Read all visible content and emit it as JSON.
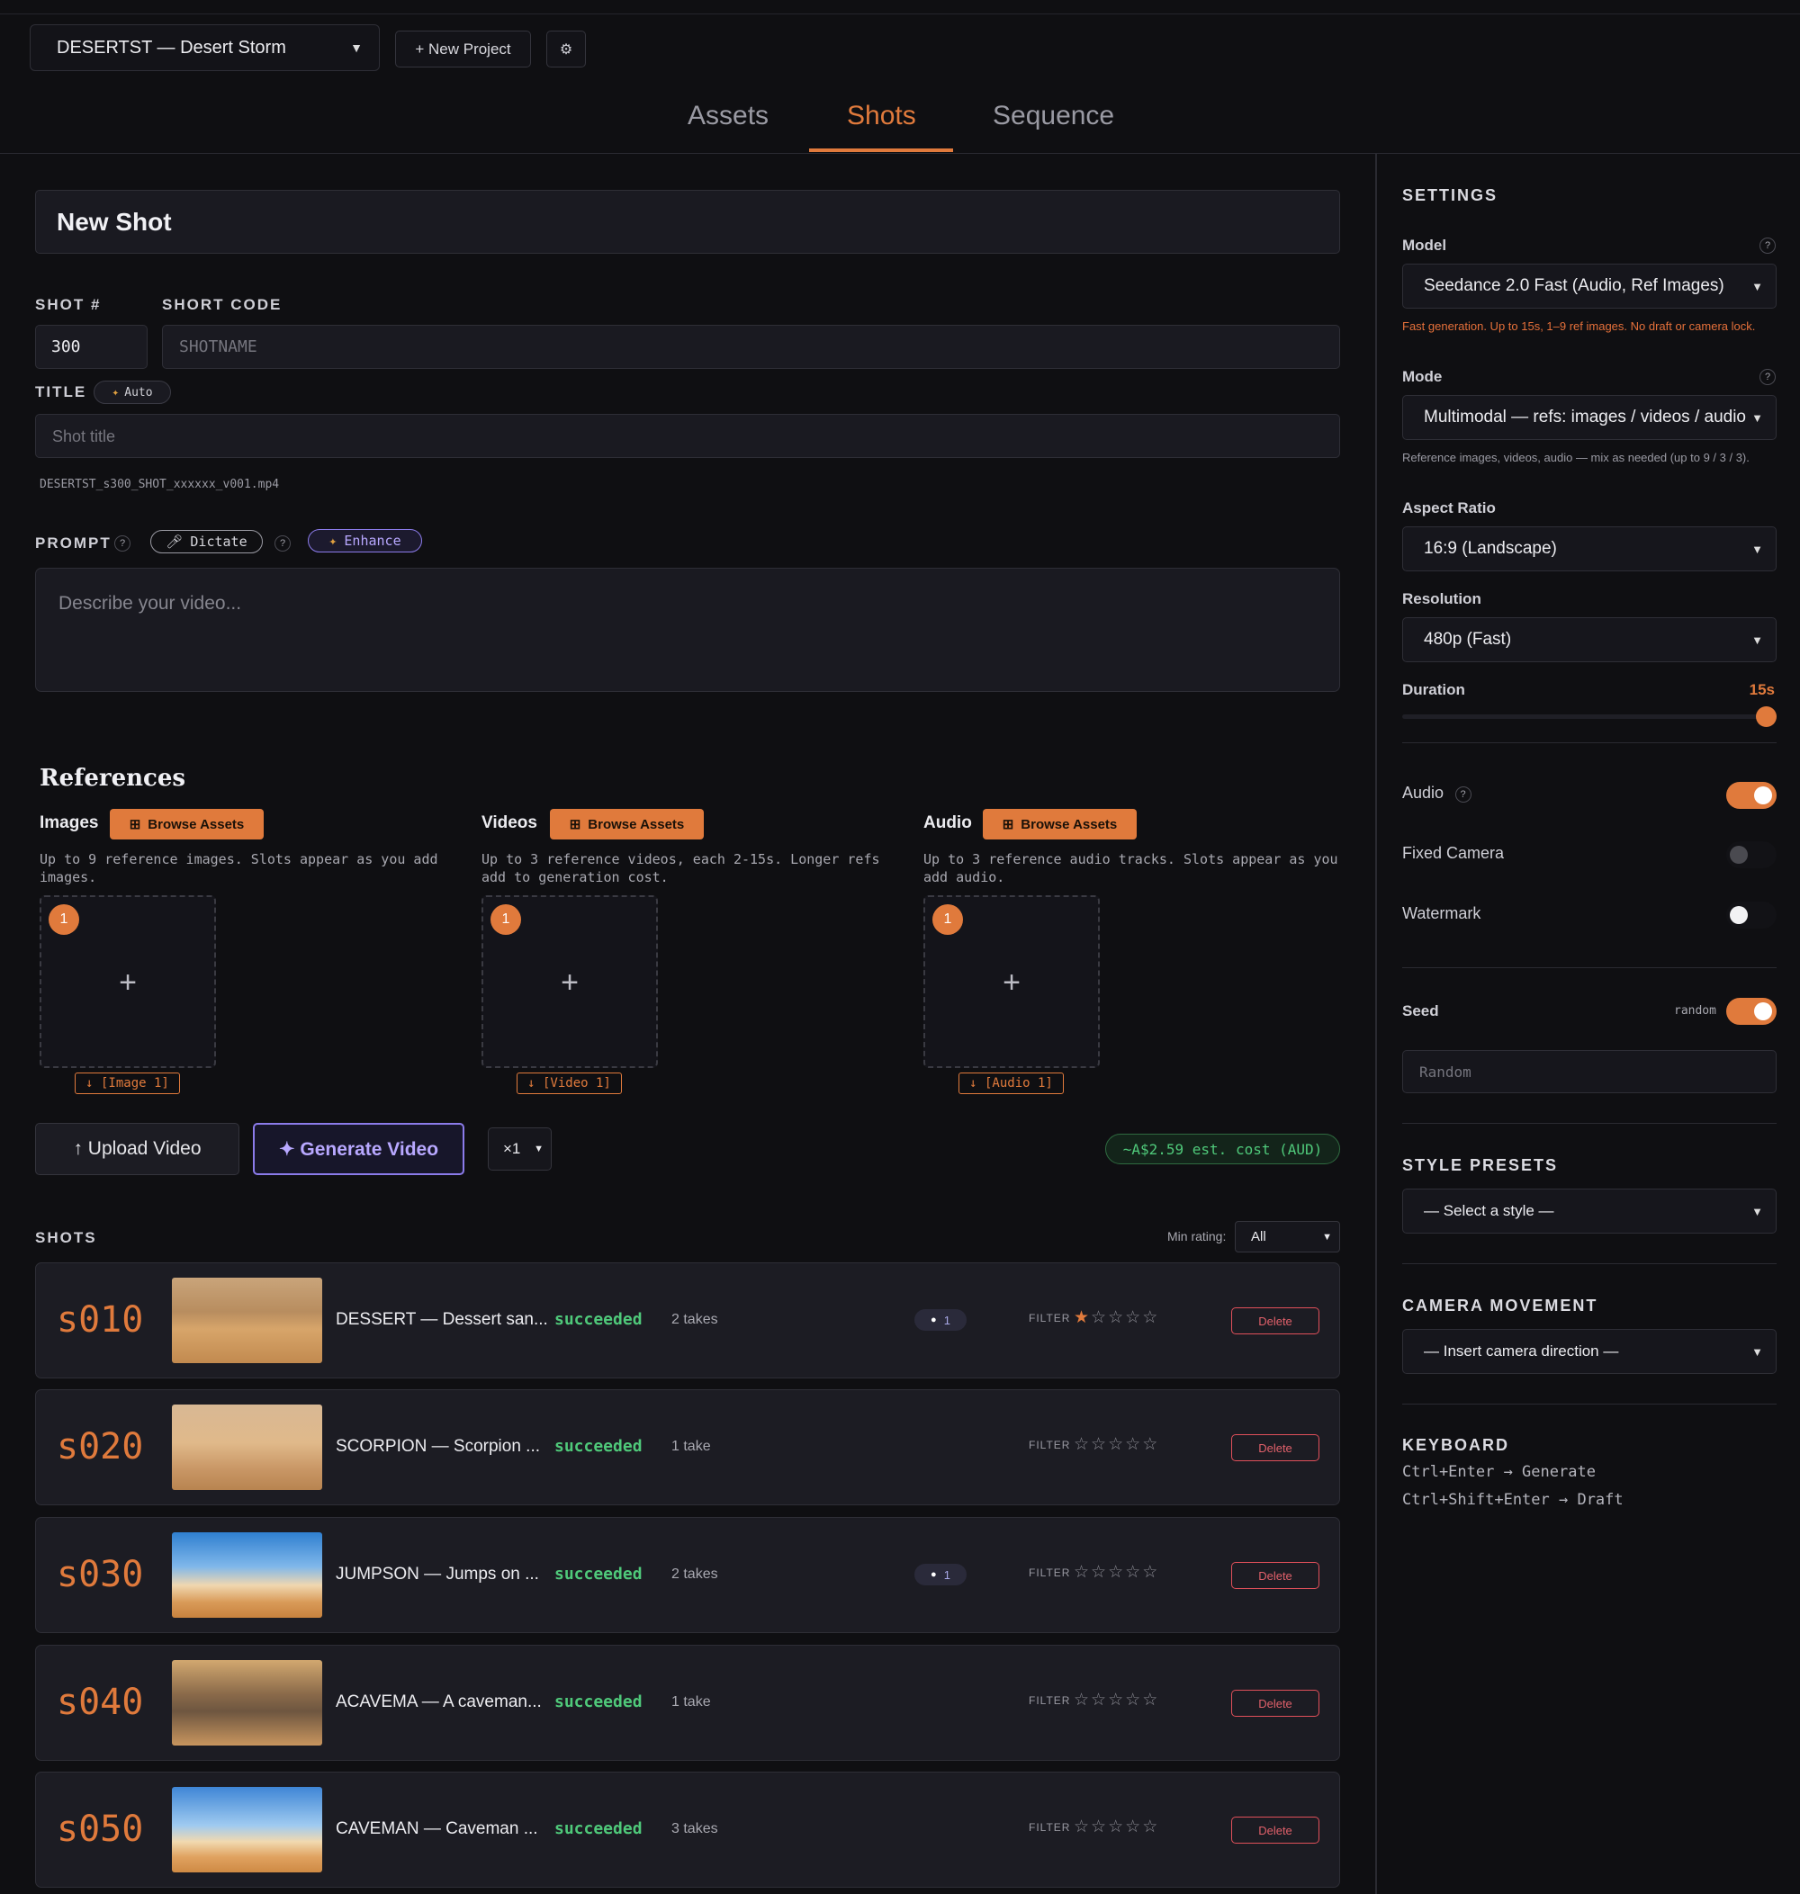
{
  "header": {
    "project": "DESERTST — Desert Storm",
    "new_project": "+ New Project",
    "settings_glyph": "⚙",
    "tabs": [
      "Assets",
      "Shots",
      "Sequence"
    ],
    "active_tab": "Shots"
  },
  "form": {
    "heading": "New Shot",
    "shot_num_label": "SHOT #",
    "short_code_label": "SHORT CODE",
    "shot_num_value": "300",
    "short_code_placeholder": "SHOTNAME",
    "title_label": "TITLE",
    "auto_label": "Auto",
    "title_placeholder": "Shot title",
    "filename": "DESERTST_s300_SHOT_xxxxxx_v001.mp4",
    "prompt_label": "PROMPT",
    "dictate_label": "Dictate",
    "enhance_label": "Enhance",
    "prompt_placeholder": "Describe your video..."
  },
  "references": {
    "heading": "References",
    "browse_label": "Browse Assets",
    "images": {
      "title": "Images",
      "desc": "Up to 9 reference images. Slots appear as you add images.",
      "slot_num": "1",
      "tag": "↓ [Image 1]"
    },
    "videos": {
      "title": "Videos",
      "desc": "Up to 3 reference videos, each 2-15s. Longer refs add to generation cost.",
      "slot_num": "1",
      "tag": "↓ [Video 1]"
    },
    "audio": {
      "title": "Audio",
      "desc": "Up to 3 reference audio tracks. Slots appear as you add audio.",
      "slot_num": "1",
      "tag": "↓ [Audio 1]"
    }
  },
  "actions": {
    "upload": "↑ Upload Video",
    "generate": "✦ Generate Video",
    "count": "×1",
    "cost": "~A$2.59 est. cost (AUD)"
  },
  "shots": {
    "label": "SHOTS",
    "min_rating_label": "Min rating:",
    "min_rating_value": "All",
    "filter_label": "FILTER",
    "delete_label": "Delete",
    "rows": [
      {
        "code": "s010",
        "title": "DESSERT — Dessert san...",
        "status": "succeeded",
        "takes": "2 takes",
        "comments": "1",
        "rating": 1
      },
      {
        "code": "s020",
        "title": "SCORPION — Scorpion ...",
        "status": "succeeded",
        "takes": "1 take",
        "comments": "",
        "rating": 0
      },
      {
        "code": "s030",
        "title": "JUMPSON — Jumps on ...",
        "status": "succeeded",
        "takes": "2 takes",
        "comments": "1",
        "rating": 0
      },
      {
        "code": "s040",
        "title": "ACAVEMA — A caveman...",
        "status": "succeeded",
        "takes": "1 take",
        "comments": "",
        "rating": 0
      },
      {
        "code": "s050",
        "title": "CAVEMAN — Caveman ...",
        "status": "succeeded",
        "takes": "3 takes",
        "comments": "",
        "rating": 0
      }
    ]
  },
  "sidebar": {
    "settings_title": "SETTINGS",
    "model_label": "Model",
    "model_value": "Seedance 2.0 Fast (Audio, Ref Images)",
    "model_help": "Fast generation. Up to 15s, 1–9 ref images. No draft or camera lock.",
    "mode_label": "Mode",
    "mode_value": "Multimodal — refs: images / videos / audio",
    "mode_help": "Reference images, videos, audio — mix as needed (up to 9 / 3 / 3).",
    "aspect_label": "Aspect Ratio",
    "aspect_value": "16:9 (Landscape)",
    "resolution_label": "Resolution",
    "resolution_value": "480p (Fast)",
    "duration_label": "Duration",
    "duration_value": "15s",
    "duration_fraction": 1.0,
    "audio_label": "Audio",
    "audio_on": true,
    "fixed_camera_label": "Fixed Camera",
    "fixed_camera_on": false,
    "watermark_label": "Watermark",
    "watermark_on": false,
    "seed_label": "Seed",
    "seed_random_label": "random",
    "seed_random_on": true,
    "seed_placeholder": "Random",
    "style_title": "STYLE PRESETS",
    "style_value": "— Select a style —",
    "camera_title": "CAMERA MOVEMENT",
    "camera_value": "— Insert camera direction —",
    "keyboard_title": "KEYBOARD",
    "shortcut_generate": "Ctrl+Enter → Generate",
    "shortcut_draft": "Ctrl+Shift+Enter → Draft"
  },
  "colors": {
    "accent": "#e07a3c",
    "success": "#4fc97a",
    "danger": "#e0505a",
    "violet": "#a78bfa",
    "background": "#0f0f12"
  }
}
